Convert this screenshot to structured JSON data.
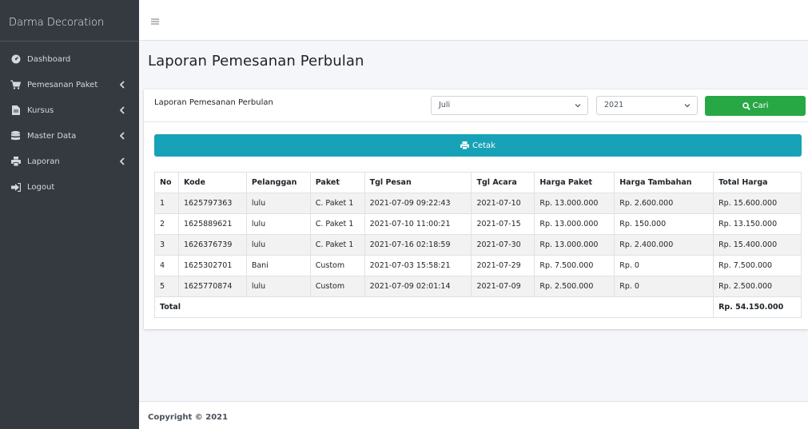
{
  "sidebar": {
    "brand": "Darma Decoration",
    "items": [
      {
        "label": "Dashboard",
        "icon": "dashboard-gauge-icon",
        "has_chevron": false
      },
      {
        "label": "Pemesanan Paket",
        "icon": "shopping-cart-icon",
        "has_chevron": true
      },
      {
        "label": "Kursus",
        "icon": "document-icon",
        "has_chevron": true
      },
      {
        "label": "Master Data",
        "icon": "database-icon",
        "has_chevron": true
      },
      {
        "label": "Laporan",
        "icon": "printer-icon",
        "has_chevron": true
      },
      {
        "label": "Logout",
        "icon": "sign-out-icon",
        "has_chevron": false
      }
    ]
  },
  "page": {
    "title": "Laporan Pemesanan Perbulan"
  },
  "card": {
    "title": "Laporan Pemesanan Perbulan",
    "month_select": "Juli",
    "year_select": "2021",
    "search_button": "Cari",
    "print_button": "Cetak"
  },
  "table": {
    "headers": [
      "No",
      "Kode",
      "Pelanggan",
      "Paket",
      "Tgl Pesan",
      "Tgl Acara",
      "Harga Paket",
      "Harga Tambahan",
      "Total Harga"
    ],
    "rows": [
      [
        "1",
        "1625797363",
        "lulu",
        "C. Paket 1",
        "2021-07-09 09:22:43",
        "2021-07-10",
        "Rp. 13.000.000",
        "Rp. 2.600.000",
        "Rp. 15.600.000"
      ],
      [
        "2",
        "1625889621",
        "lulu",
        "C. Paket 1",
        "2021-07-10 11:00:21",
        "2021-07-15",
        "Rp. 13.000.000",
        "Rp. 150.000",
        "Rp. 13.150.000"
      ],
      [
        "3",
        "1626376739",
        "lulu",
        "C. Paket 1",
        "2021-07-16 02:18:59",
        "2021-07-30",
        "Rp. 13.000.000",
        "Rp. 2.400.000",
        "Rp. 15.400.000"
      ],
      [
        "4",
        "1625302701",
        "Bani",
        "Custom",
        "2021-07-03 15:58:21",
        "2021-07-29",
        "Rp. 7.500.000",
        "Rp. 0",
        "Rp. 7.500.000"
      ],
      [
        "5",
        "1625770874",
        "lulu",
        "Custom",
        "2021-07-09 02:01:14",
        "2021-07-09",
        "Rp. 2.500.000",
        "Rp. 0",
        "Rp. 2.500.000"
      ]
    ],
    "total_label": "Total",
    "total_value": "Rp. 54.150.000"
  },
  "footer": {
    "copyright": "Copyright © 2021"
  },
  "colors": {
    "sidebar_bg": "#343a40",
    "content_bg": "#f4f6f9",
    "success": "#28a745",
    "info": "#17a2b8"
  }
}
